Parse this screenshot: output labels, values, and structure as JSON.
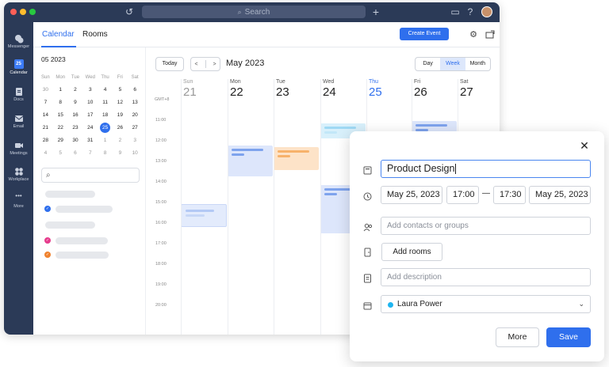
{
  "titlebar": {
    "search_placeholder": "Search"
  },
  "nav": {
    "items": [
      {
        "label": "Messenger",
        "icon": "messenger-icon"
      },
      {
        "label": "Calendar",
        "icon": "calendar-icon",
        "badge": "25"
      },
      {
        "label": "Docs",
        "icon": "docs-icon"
      },
      {
        "label": "Email",
        "icon": "email-icon"
      },
      {
        "label": "Meetings",
        "icon": "meetings-icon"
      },
      {
        "label": "Workplace",
        "icon": "workplace-icon"
      },
      {
        "label": "More",
        "icon": "more-icon"
      }
    ]
  },
  "tabs": {
    "calendar": "Calendar",
    "rooms": "Rooms",
    "create_event": "Create Event"
  },
  "mini_calendar": {
    "title": "05 2023",
    "weekdays": [
      "Sun",
      "Mon",
      "Tue",
      "Wed",
      "Thu",
      "Fri",
      "Sat"
    ],
    "weeks": [
      [
        "30",
        "1",
        "2",
        "3",
        "4",
        "5",
        "6"
      ],
      [
        "7",
        "8",
        "9",
        "10",
        "11",
        "12",
        "13"
      ],
      [
        "14",
        "15",
        "16",
        "17",
        "18",
        "19",
        "20"
      ],
      [
        "21",
        "22",
        "23",
        "24",
        "25",
        "26",
        "27"
      ],
      [
        "28",
        "29",
        "30",
        "31",
        "1",
        "2",
        "3"
      ],
      [
        "4",
        "5",
        "6",
        "7",
        "8",
        "9",
        "10"
      ]
    ],
    "selected": "25"
  },
  "toolbar": {
    "today": "Today",
    "prev": "<",
    "next": ">",
    "month_title": "May 2023",
    "views": [
      "Day",
      "Week",
      "Month"
    ],
    "active_view": "Week"
  },
  "week": {
    "timezone": "GMT+8",
    "days": [
      {
        "name": "Sun",
        "date": "21"
      },
      {
        "name": "Mon",
        "date": "22"
      },
      {
        "name": "Tue",
        "date": "23"
      },
      {
        "name": "Wed",
        "date": "24"
      },
      {
        "name": "Thu",
        "date": "25"
      },
      {
        "name": "Fri",
        "date": "26"
      },
      {
        "name": "Sat",
        "date": "27"
      }
    ],
    "times": [
      "11:00",
      "12:00",
      "13:00",
      "14:00",
      "15:00",
      "16:00",
      "17:00",
      "18:00",
      "19:00",
      "20:00"
    ]
  },
  "popup": {
    "title_value": "Product Design",
    "start_date": "May 25, 2023",
    "start_time": "17:00",
    "separator": "—",
    "end_time": "17:30",
    "end_date": "May 25, 2023",
    "contacts_placeholder": "Add contacts or groups",
    "rooms_button": "Add rooms",
    "description_placeholder": "Add description",
    "calendar_owner": "Laura Power",
    "more_button": "More",
    "save_button": "Save"
  },
  "colors": {
    "accent": "#2f6fed",
    "nav_bg": "#2b3a57",
    "event_blue": "#dde6fb",
    "event_orange": "#fde5cc",
    "owner_dot": "#1fb5f0"
  }
}
